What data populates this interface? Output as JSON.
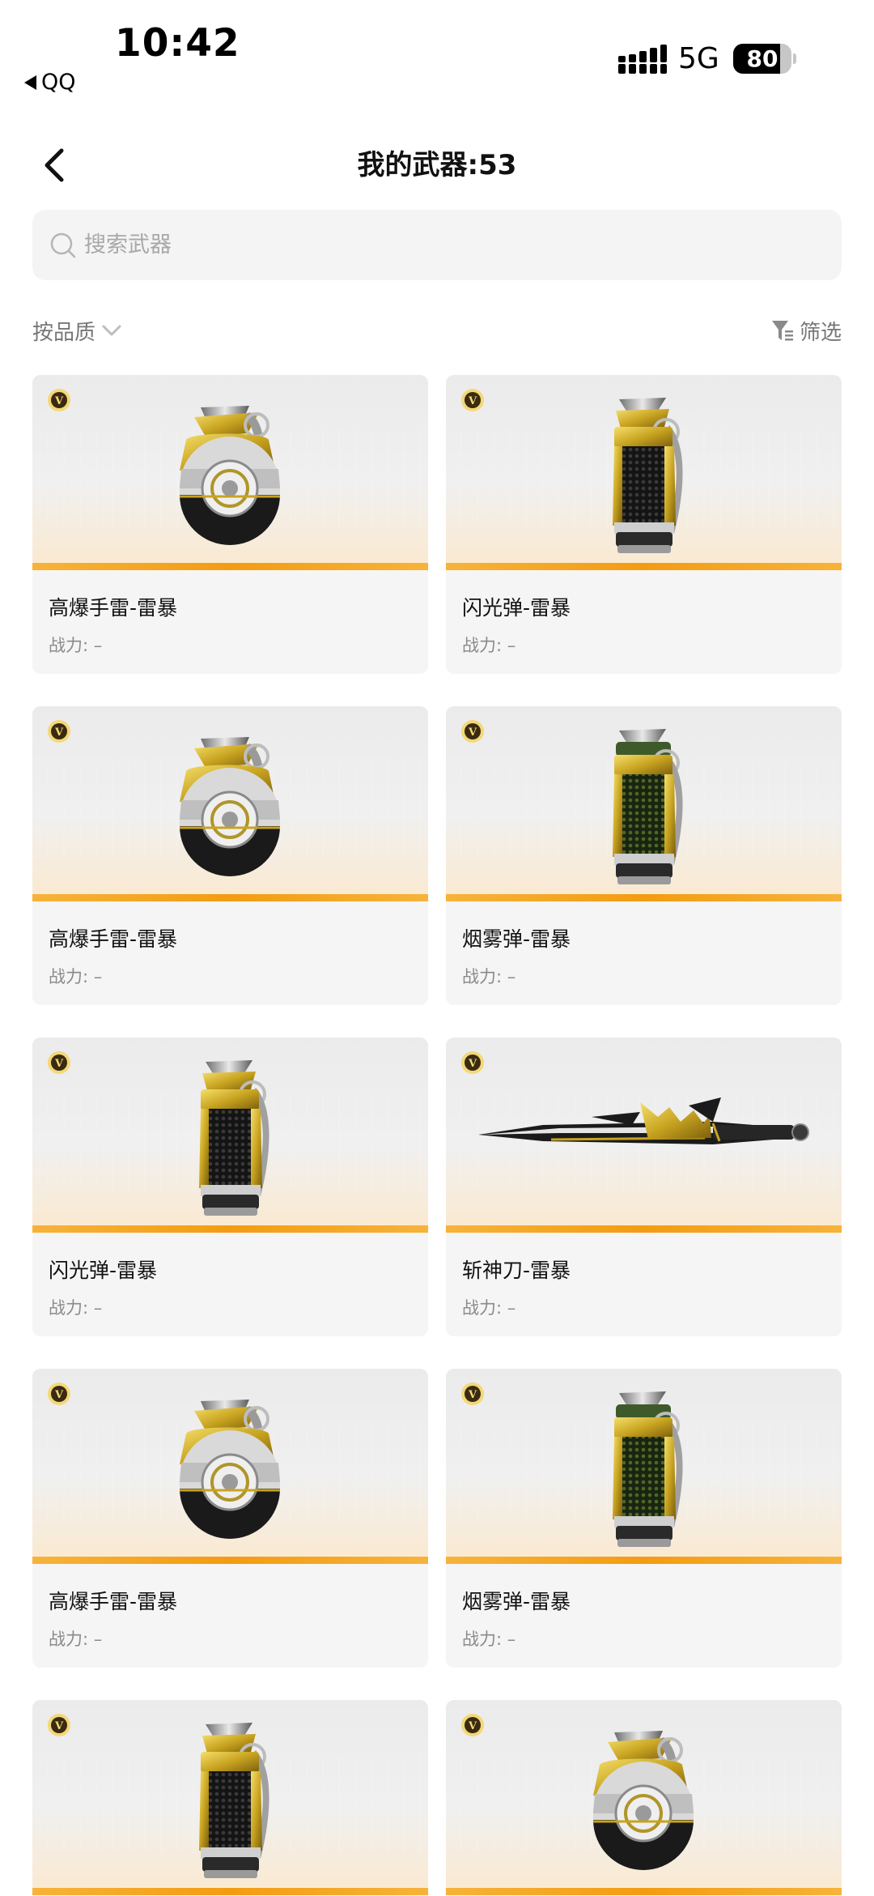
{
  "status_bar": {
    "time": "10:42",
    "back_app": "QQ",
    "network": "5G",
    "battery": 80
  },
  "header": {
    "title": "我的武器:53"
  },
  "search": {
    "placeholder": "搜索武器"
  },
  "toolbar": {
    "sort_label": "按品质",
    "filter_label": "筛选"
  },
  "badge_letter": "V",
  "accent_color": "#f39c12",
  "weapons": [
    {
      "name": "高爆手雷-雷暴",
      "power": "战力: –",
      "icon": "frag-grenade-icon"
    },
    {
      "name": "闪光弹-雷暴",
      "power": "战力: –",
      "icon": "flashbang-icon"
    },
    {
      "name": "高爆手雷-雷暴",
      "power": "战力: –",
      "icon": "frag-grenade-icon"
    },
    {
      "name": "烟雾弹-雷暴",
      "power": "战力: –",
      "icon": "smoke-grenade-icon"
    },
    {
      "name": "闪光弹-雷暴",
      "power": "战力: –",
      "icon": "flashbang-icon"
    },
    {
      "name": "斩神刀-雷暴",
      "power": "战力: –",
      "icon": "blade-icon"
    },
    {
      "name": "高爆手雷-雷暴",
      "power": "战力: –",
      "icon": "frag-grenade-icon"
    },
    {
      "name": "烟雾弹-雷暴",
      "power": "战力: –",
      "icon": "smoke-grenade-icon"
    },
    {
      "name": "",
      "power": "",
      "icon": "flashbang-icon"
    },
    {
      "name": "",
      "power": "",
      "icon": "frag-grenade-icon"
    }
  ]
}
